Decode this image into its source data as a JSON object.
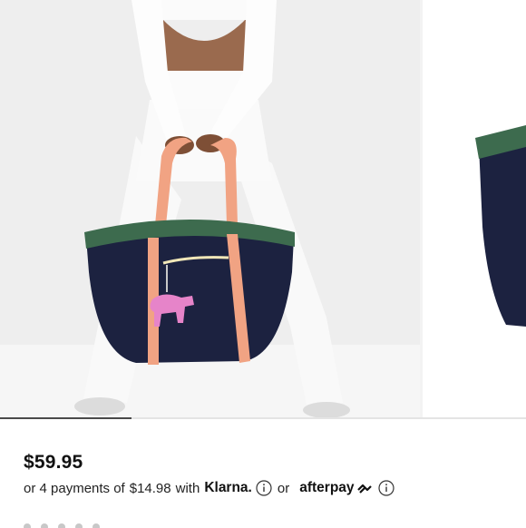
{
  "gallery": {
    "images": [
      {
        "label": "model-holding-tote-bag"
      },
      {
        "label": "tote-bag-side-view"
      }
    ],
    "progress_fraction": 0.25
  },
  "product": {
    "price": "$59.95"
  },
  "payments": {
    "prefix": "or 4 payments of",
    "amount": "$14.98",
    "with_word": "with",
    "provider_one": "Klarna.",
    "or_word": "or",
    "provider_two": "afterpay"
  },
  "colors": {
    "bag_body": "#1c2240",
    "bag_trim": "#3d6b4e",
    "strap": "#f1a383",
    "charm": "#e684c9"
  },
  "icons": [
    "info-icon",
    "afterpay-arrows-icon"
  ]
}
